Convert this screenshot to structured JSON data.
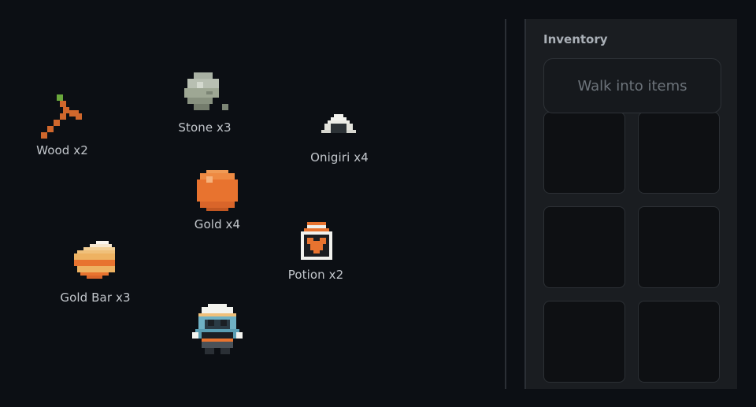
{
  "world": {
    "items": [
      {
        "id": "wood",
        "label": "Wood x2",
        "icon": "stick-icon"
      },
      {
        "id": "stone",
        "label": "Stone x3",
        "icon": "stone-icon"
      },
      {
        "id": "onigiri",
        "label": "Onigiri x4",
        "icon": "onigiri-icon"
      },
      {
        "id": "gold",
        "label": "Gold x4",
        "icon": "gold-coin-icon"
      },
      {
        "id": "potion",
        "label": "Potion x2",
        "icon": "potion-icon"
      },
      {
        "id": "goldbar",
        "label": "Gold Bar x3",
        "icon": "gold-bar-icon"
      }
    ],
    "player": {
      "icon": "player-character-icon"
    }
  },
  "inventory": {
    "title": "Inventory",
    "hint": "Walk into items",
    "slot_count": 6
  },
  "colors": {
    "background": "#0c0f14",
    "panel": "#1a1d21",
    "gold": "#e8732f",
    "label": "#c3c7cc"
  }
}
